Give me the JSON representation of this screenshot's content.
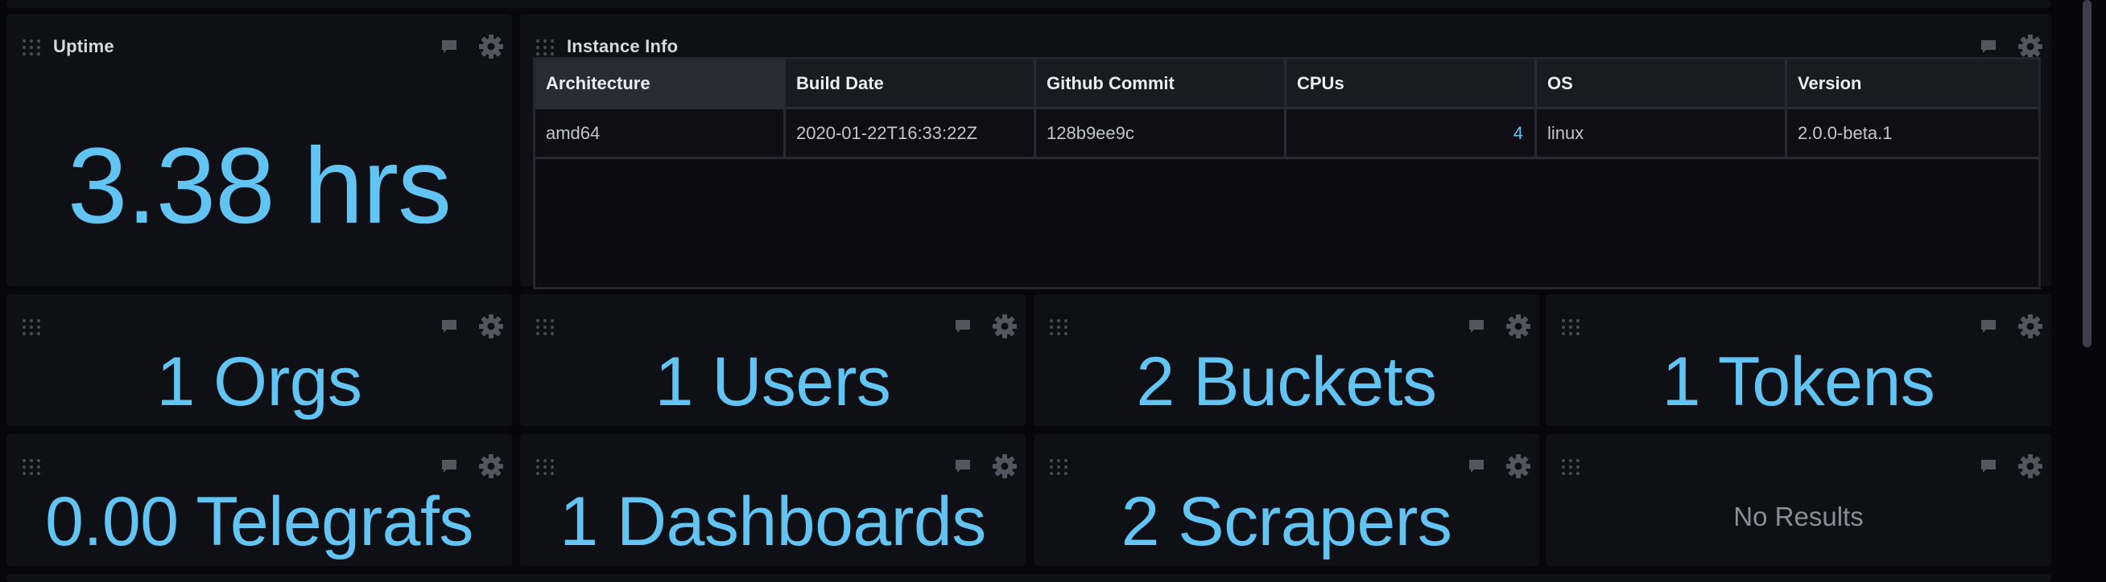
{
  "uptime": {
    "title": "Uptime",
    "value": "3.38 hrs"
  },
  "instance_info": {
    "title": "Instance Info",
    "columns": [
      "Architecture",
      "Build Date",
      "Github Commit",
      "CPUs",
      "OS",
      "Version"
    ],
    "rows": [
      [
        "amd64",
        "2020-01-22T16:33:22Z",
        "128b9ee9c",
        "4",
        "linux",
        "2.0.0-beta.1"
      ]
    ]
  },
  "stats": {
    "orgs": "1 Orgs",
    "users": "1 Users",
    "buckets": "2 Buckets",
    "tokens": "1 Tokens",
    "telegrafs": "0.00 Telegrafs",
    "dashboards": "1 Dashboards",
    "scrapers": "2 Scrapers",
    "empty": "No Results"
  },
  "colors": {
    "stat_text": "#62c4f2",
    "cell_background": "#0f0f16",
    "page_background": "#07070b"
  },
  "icons": [
    "drag-handle-icon",
    "note-icon",
    "gear-icon"
  ]
}
